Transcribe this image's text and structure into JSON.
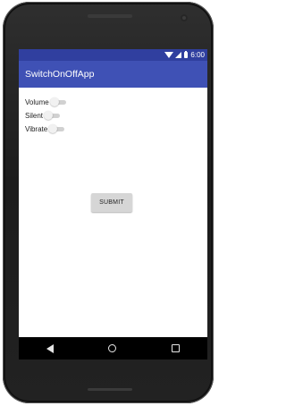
{
  "status_bar": {
    "time": "6:00"
  },
  "toolbar": {
    "title": "SwitchOnOffApp"
  },
  "switches": [
    {
      "label": "Volume",
      "state": "off"
    },
    {
      "label": "Silent",
      "state": "off"
    },
    {
      "label": "Vibrate",
      "state": "off"
    }
  ],
  "submit": {
    "label": "SUBMIT"
  },
  "nav": {
    "back_icon": "back-triangle",
    "home_icon": "home-circle",
    "recents_icon": "recents-square"
  },
  "colors": {
    "status_bar": "#303f9f",
    "toolbar": "#3f51b5",
    "button": "#d6d6d6"
  }
}
